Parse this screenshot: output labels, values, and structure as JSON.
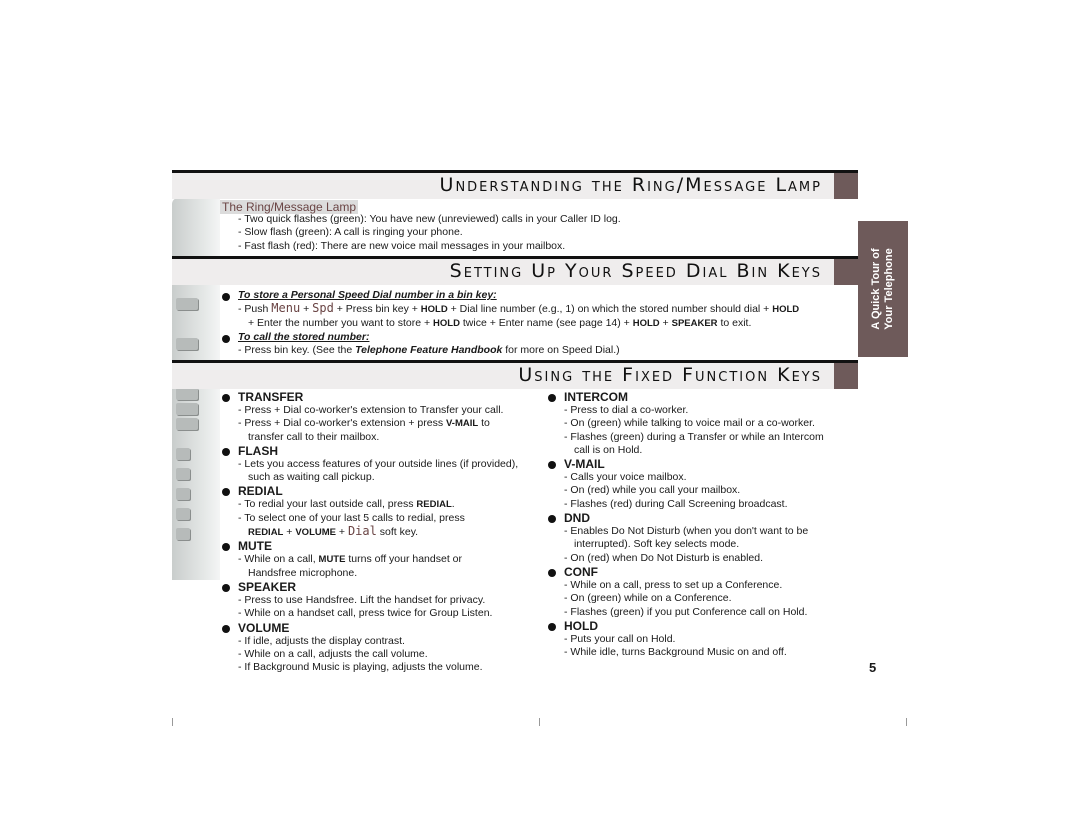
{
  "sections": {
    "ring_lamp": {
      "title": "Understanding the Ring/Message Lamp",
      "subtitle": "The Ring/Message Lamp",
      "lines": [
        "- Two quick flashes (green): You have new (unreviewed) calls in your Caller ID log.",
        "- Slow flash (green): A call is ringing your phone.",
        "- Fast flash (red): There are new voice mail messages in your mailbox."
      ]
    },
    "speed_dial": {
      "title": "Setting Up Your Speed Dial Bin Keys",
      "store_heading": "To store a Personal Speed Dial number in a bin key:",
      "store_line1": [
        {
          "t": "- Push "
        },
        {
          "t": "Menu",
          "m": 1
        },
        {
          "t": " + "
        },
        {
          "t": "Spd",
          "m": 1
        },
        {
          "t": " + Press bin key + "
        },
        {
          "t": "HOLD",
          "b": 1
        },
        {
          "t": " + Dial line number (e.g., 1) on which the stored number should dial + "
        },
        {
          "t": "HOLD",
          "b": 1
        }
      ],
      "store_line2": [
        {
          "t": "+ Enter the number you want to store + "
        },
        {
          "t": "HOLD",
          "b": 1
        },
        {
          "t": " twice + Enter name (see page 14) + "
        },
        {
          "t": "HOLD",
          "b": 1
        },
        {
          "t": " + "
        },
        {
          "t": "SPEAKER",
          "b": 1
        },
        {
          "t": " to exit."
        }
      ],
      "call_heading": "To call the stored number:",
      "call_line": [
        {
          "t": "- Press bin key.  (See the "
        },
        {
          "t": "Telephone Feature Handbook",
          "i": 1
        },
        {
          "t": " for more on Speed Dial.)"
        }
      ]
    },
    "fixed_keys": {
      "title": "Using the Fixed Function Keys",
      "left": [
        {
          "key": "TRANSFER",
          "lines": [
            [
              {
                "t": "- Press + Dial co-worker's extension to Transfer your call."
              }
            ],
            [
              {
                "t": "- Press + Dial co-worker's extension + press "
              },
              {
                "t": "V-MAIL",
                "b": 1
              },
              {
                "t": " to"
              }
            ],
            [
              {
                "t": "transfer call to their mailbox.",
                "c": 1
              }
            ]
          ]
        },
        {
          "key": "FLASH",
          "lines": [
            [
              {
                "t": "- Lets you access features of your outside lines (if provided),"
              }
            ],
            [
              {
                "t": "such as waiting call pickup.",
                "c": 1
              }
            ]
          ]
        },
        {
          "key": "REDIAL",
          "lines": [
            [
              {
                "t": "- To redial your last outside call, press "
              },
              {
                "t": "REDIAL",
                "b": 1
              },
              {
                "t": "."
              }
            ],
            [
              {
                "t": "- To select one of your last 5 calls to redial, press"
              }
            ],
            [
              {
                "t": "REDIAL",
                "b": 1,
                "c": 1
              },
              {
                "t": " + "
              },
              {
                "t": "VOLUME",
                "b": 1
              },
              {
                "t": " + "
              },
              {
                "t": "Dial",
                "m": 1
              },
              {
                "t": " soft key."
              }
            ]
          ]
        },
        {
          "key": "MUTE",
          "lines": [
            [
              {
                "t": "- While on a call, "
              },
              {
                "t": "MUTE",
                "b": 1
              },
              {
                "t": " turns off your handset or"
              }
            ],
            [
              {
                "t": "Handsfree microphone.",
                "c": 1
              }
            ]
          ]
        },
        {
          "key": "SPEAKER",
          "lines": [
            [
              {
                "t": "- Press to use Handsfree. Lift the handset for privacy."
              }
            ],
            [
              {
                "t": "- While on a handset call, press twice for Group Listen."
              }
            ]
          ]
        },
        {
          "key": "VOLUME",
          "lines": [
            [
              {
                "t": "- If idle, adjusts the display contrast."
              }
            ],
            [
              {
                "t": "- While on a call, adjusts the call volume."
              }
            ],
            [
              {
                "t": "- If Background Music is playing, adjusts the volume."
              }
            ]
          ]
        }
      ],
      "right": [
        {
          "key": "INTERCOM",
          "lines": [
            [
              {
                "t": "- Press to dial a co-worker."
              }
            ],
            [
              {
                "t": "- On (green) while talking to voice mail or a co-worker."
              }
            ],
            [
              {
                "t": "- Flashes (green) during a Transfer or while an Intercom"
              }
            ],
            [
              {
                "t": "call is on Hold.",
                "c": 1
              }
            ]
          ]
        },
        {
          "key": "V-MAIL",
          "lines": [
            [
              {
                "t": "- Calls your voice mailbox."
              }
            ],
            [
              {
                "t": "- On (red) while you call your mailbox."
              }
            ],
            [
              {
                "t": "- Flashes (red) during Call Screening broadcast."
              }
            ]
          ]
        },
        {
          "key": "DND",
          "lines": [
            [
              {
                "t": "- Enables Do Not Disturb (when you don't want to be"
              }
            ],
            [
              {
                "t": "interrupted). Soft key selects mode.",
                "c": 1
              }
            ],
            [
              {
                "t": "- On (red) when Do Not Disturb is enabled."
              }
            ]
          ]
        },
        {
          "key": "CONF",
          "lines": [
            [
              {
                "t": "- While on a call, press to set up a Conference."
              }
            ],
            [
              {
                "t": "- On (green) while on a Conference."
              }
            ],
            [
              {
                "t": "- Flashes (green) if you put Conference call on Hold."
              }
            ]
          ]
        },
        {
          "key": "HOLD",
          "lines": [
            [
              {
                "t": "- Puts your call on Hold."
              }
            ],
            [
              {
                "t": "- While idle, turns Background Music on and off."
              }
            ]
          ]
        }
      ]
    }
  },
  "side_tab": {
    "line1": "A Quick Tour of",
    "line2": "Your Telephone"
  },
  "page_number": "5",
  "colors": {
    "accent": "#6e5a5a",
    "header_bg": "#efeded",
    "subtitle": "#6a4444"
  }
}
